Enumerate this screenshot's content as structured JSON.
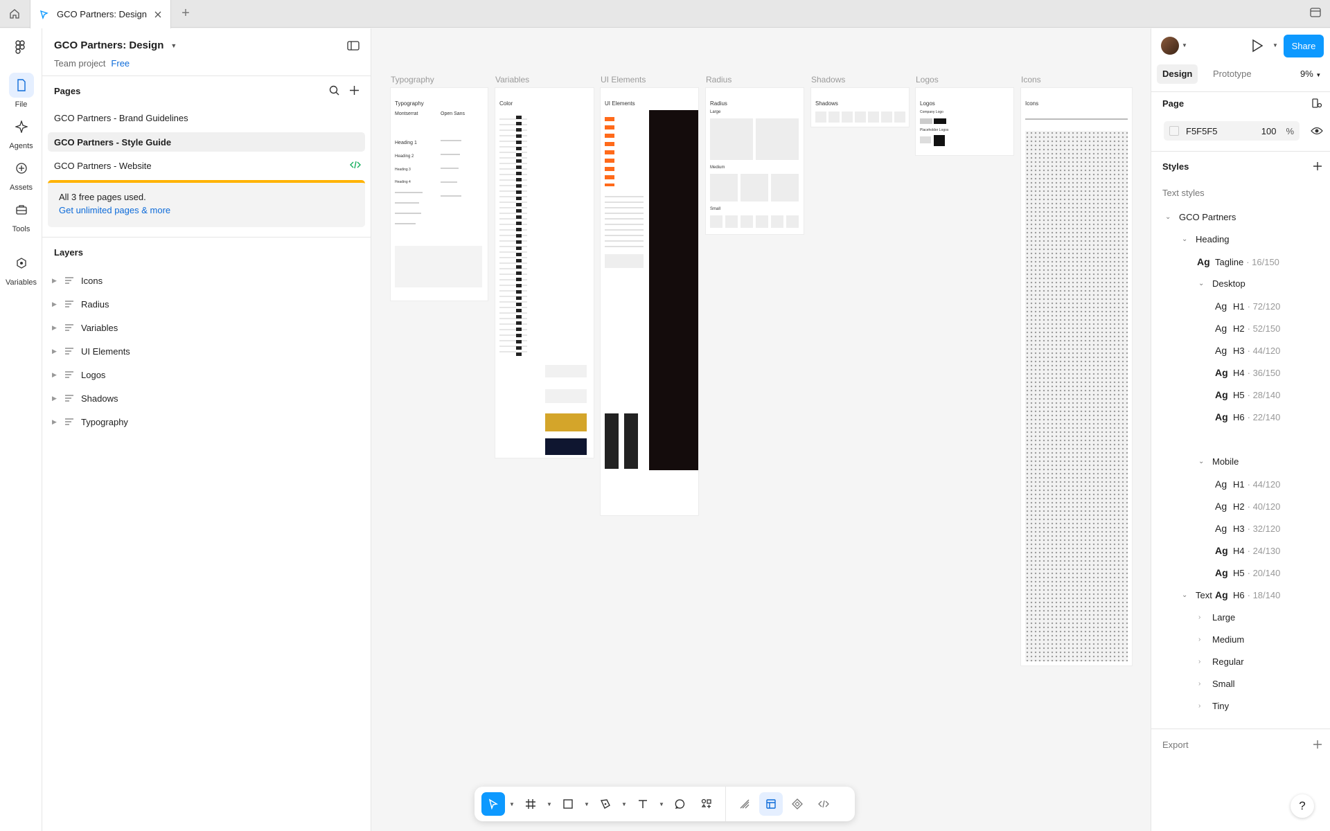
{
  "tabbar": {
    "tab_title": "GCO Partners: Design"
  },
  "rail": {
    "items": [
      {
        "label": "File"
      },
      {
        "label": "Agents"
      },
      {
        "label": "Assets"
      },
      {
        "label": "Tools"
      },
      {
        "label": "Variables"
      }
    ]
  },
  "file": {
    "name": "GCO Partners: Design",
    "project": "Team project",
    "plan": "Free"
  },
  "pages": {
    "title": "Pages",
    "items": [
      "GCO Partners - Brand Guidelines",
      "GCO Partners - Style Guide",
      "GCO Partners - Website"
    ],
    "selected_index": 1,
    "upsell_text": "All 3 free pages used.",
    "upsell_link": "Get unlimited pages & more"
  },
  "layers": {
    "title": "Layers",
    "items": [
      "Icons",
      "Radius",
      "Variables",
      "UI Elements",
      "Logos",
      "Shadows",
      "Typography"
    ]
  },
  "canvas": {
    "frames": [
      {
        "label": "Typography",
        "title": "Typography"
      },
      {
        "label": "Variables",
        "title": "Color"
      },
      {
        "label": "UI Elements",
        "title": "UI Elements"
      },
      {
        "label": "Radius",
        "title": "Radius"
      },
      {
        "label": "Shadows",
        "title": "Shadows"
      },
      {
        "label": "Logos",
        "title": "Logos"
      },
      {
        "label": "Icons",
        "title": "Icons"
      }
    ],
    "typography_fonts": [
      "Montserrat",
      "Open Sans"
    ],
    "typography_headings": [
      "Heading 1",
      "Heading 2",
      "Heading 3",
      "Heading 4"
    ],
    "radius_labels": [
      "Large",
      "Medium",
      "Small"
    ],
    "logos_labels": [
      "Company Logo",
      "Placeholder Logos"
    ]
  },
  "right": {
    "share_label": "Share",
    "tabs": [
      "Design",
      "Prototype"
    ],
    "zoom": "9%",
    "page_section": "Page",
    "page_color": "F5F5F5",
    "page_opacity": "100",
    "page_opacity_unit": "%",
    "styles_section": "Styles",
    "text_styles_label": "Text styles",
    "group": "GCO Partners",
    "heading_group": "Heading",
    "tagline": {
      "name": "Tagline",
      "meta": "· 16/150"
    },
    "desktop_label": "Desktop",
    "desktop": [
      {
        "name": "H1",
        "meta": "· 72/120"
      },
      {
        "name": "H2",
        "meta": "· 52/150"
      },
      {
        "name": "H3",
        "meta": "· 44/120"
      },
      {
        "name": "H4",
        "meta": "· 36/150"
      },
      {
        "name": "H5",
        "meta": "· 28/140"
      },
      {
        "name": "H6",
        "meta": "· 22/140"
      }
    ],
    "mobile_label": "Mobile",
    "mobile": [
      {
        "name": "H1",
        "meta": "· 44/120"
      },
      {
        "name": "H2",
        "meta": "· 40/120"
      },
      {
        "name": "H3",
        "meta": "· 32/120"
      },
      {
        "name": "H4",
        "meta": "· 24/130"
      },
      {
        "name": "H5",
        "meta": "· 20/140"
      },
      {
        "name": "H6",
        "meta": "· 18/140"
      }
    ],
    "text_group": "Text",
    "text_items": [
      "Large",
      "Medium",
      "Regular",
      "Small",
      "Tiny"
    ],
    "export_label": "Export",
    "ag_glyph": "Ag",
    "help_label": "?"
  }
}
